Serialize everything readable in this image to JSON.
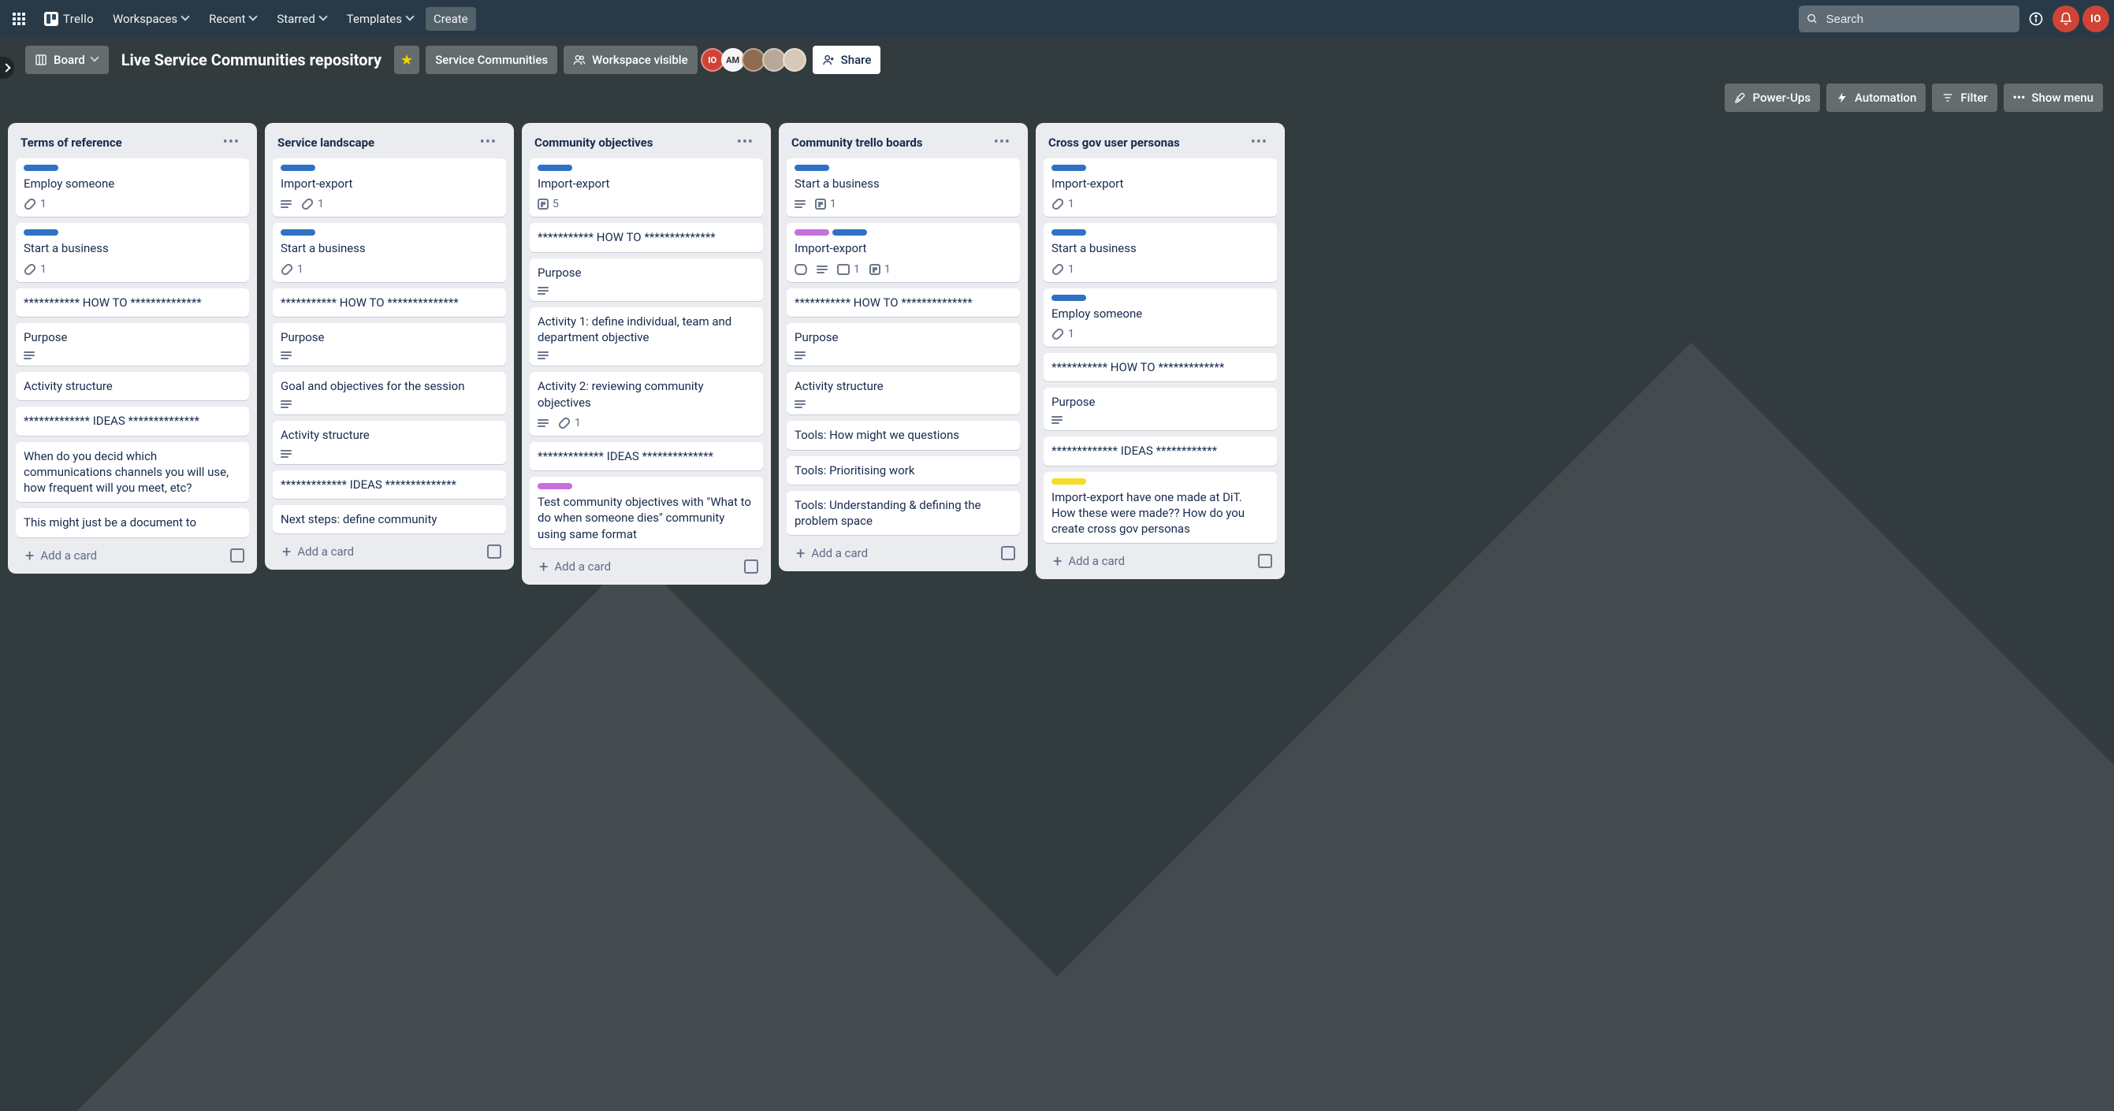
{
  "nav": {
    "logo": "Trello",
    "workspaces": "Workspaces",
    "recent": "Recent",
    "starred": "Starred",
    "templates": "Templates",
    "create": "Create",
    "search_placeholder": "Search",
    "avatar_initials": "IO"
  },
  "boardbar": {
    "view": "Board",
    "title": "Live Service Communities repository",
    "workspace": "Service Communities",
    "visibility": "Workspace visible",
    "share": "Share",
    "powerups": "Power-Ups",
    "automation": "Automation",
    "filter": "Filter",
    "show_menu": "Show menu",
    "members": [
      "IO",
      "AM",
      "",
      "",
      ""
    ]
  },
  "add_card_label": "Add a card",
  "lists": [
    {
      "title": "Terms of reference",
      "cards": [
        {
          "labels": [
            "blue"
          ],
          "title": "Employ someone",
          "badges": [
            {
              "type": "attach",
              "val": "1"
            }
          ]
        },
        {
          "labels": [
            "blue"
          ],
          "title": "Start a business",
          "badges": [
            {
              "type": "attach",
              "val": "1"
            }
          ]
        },
        {
          "title": "*********** HOW TO **************"
        },
        {
          "title": "Purpose",
          "badges": [
            {
              "type": "desc"
            }
          ]
        },
        {
          "title": "Activity structure"
        },
        {
          "title": "************* IDEAS **************"
        },
        {
          "title": "When do you decid which communications channels you will use, how frequent will you meet, etc?"
        },
        {
          "title": "This might just be a document to"
        }
      ]
    },
    {
      "title": "Service landscape",
      "cards": [
        {
          "labels": [
            "blue"
          ],
          "title": "Import-export",
          "badges": [
            {
              "type": "desc"
            },
            {
              "type": "attach",
              "val": "1"
            }
          ]
        },
        {
          "labels": [
            "blue"
          ],
          "title": "Start a business",
          "badges": [
            {
              "type": "attach",
              "val": "1"
            }
          ]
        },
        {
          "title": "*********** HOW TO **************"
        },
        {
          "title": "Purpose",
          "badges": [
            {
              "type": "desc"
            }
          ]
        },
        {
          "title": "Goal and objectives for the session",
          "badges": [
            {
              "type": "desc"
            }
          ]
        },
        {
          "title": "Activity structure",
          "badges": [
            {
              "type": "desc"
            }
          ]
        },
        {
          "title": "************* IDEAS **************"
        },
        {
          "title": "Next steps: define community"
        }
      ]
    },
    {
      "title": "Community objectives",
      "cards": [
        {
          "labels": [
            "blue"
          ],
          "title": "Import-export",
          "badges": [
            {
              "type": "trello",
              "val": "5"
            }
          ]
        },
        {
          "title": "*********** HOW TO **************"
        },
        {
          "title": "Purpose",
          "badges": [
            {
              "type": "desc"
            }
          ]
        },
        {
          "title": "Activity 1: define individual, team and department objective",
          "badges": [
            {
              "type": "desc"
            }
          ]
        },
        {
          "title": "Activity 2: reviewing community objectives",
          "badges": [
            {
              "type": "desc"
            },
            {
              "type": "attach",
              "val": "1"
            }
          ]
        },
        {
          "title": "************* IDEAS **************"
        },
        {
          "labels": [
            "purple"
          ],
          "title": "Test community objectives with \"What to do when someone dies\" community using same format"
        }
      ]
    },
    {
      "title": "Community trello boards",
      "cards": [
        {
          "labels": [
            "blue"
          ],
          "title": "Start a business",
          "badges": [
            {
              "type": "desc"
            },
            {
              "type": "trello",
              "val": "1"
            }
          ]
        },
        {
          "labels": [
            "purple",
            "blue"
          ],
          "title": "Import-export",
          "badges": [
            {
              "type": "eye"
            },
            {
              "type": "desc"
            },
            {
              "type": "comment",
              "val": "1"
            },
            {
              "type": "trello",
              "val": "1"
            }
          ]
        },
        {
          "title": "*********** HOW TO **************"
        },
        {
          "title": "Purpose",
          "badges": [
            {
              "type": "desc"
            }
          ]
        },
        {
          "title": "Activity structure",
          "badges": [
            {
              "type": "desc"
            }
          ]
        },
        {
          "title": "Tools: How might we questions"
        },
        {
          "title": "Tools: Prioritising work"
        },
        {
          "title": "Tools: Understanding & defining the problem space"
        }
      ]
    },
    {
      "title": "Cross gov user personas",
      "cards": [
        {
          "labels": [
            "blue"
          ],
          "title": "Import-export",
          "badges": [
            {
              "type": "attach",
              "val": "1"
            }
          ]
        },
        {
          "labels": [
            "blue"
          ],
          "title": "Start a business",
          "badges": [
            {
              "type": "attach",
              "val": "1"
            }
          ]
        },
        {
          "labels": [
            "blue"
          ],
          "title": "Employ someone",
          "badges": [
            {
              "type": "attach",
              "val": "1"
            }
          ]
        },
        {
          "title": "*********** HOW TO *************"
        },
        {
          "title": "Purpose",
          "badges": [
            {
              "type": "desc"
            }
          ]
        },
        {
          "title": "************* IDEAS ************"
        },
        {
          "labels": [
            "yellow"
          ],
          "title": "Import-export have one made at DiT. How these were made?? How do you create cross gov personas"
        }
      ]
    }
  ]
}
